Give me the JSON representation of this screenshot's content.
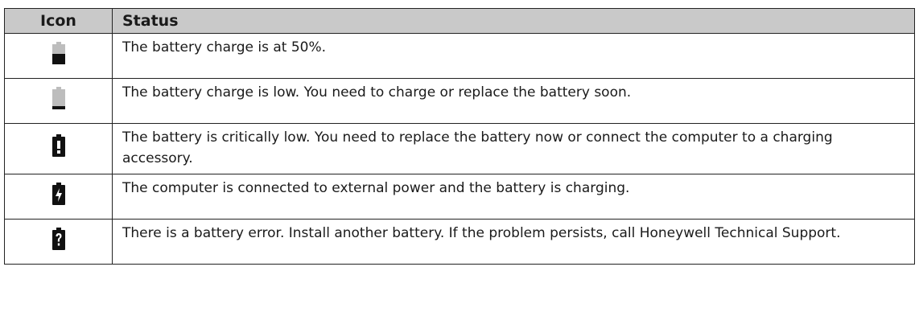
{
  "table": {
    "headers": {
      "icon": "Icon",
      "status": "Status"
    },
    "rows": [
      {
        "icon": "battery-half-icon",
        "status": "The battery charge is at 50%."
      },
      {
        "icon": "battery-low-icon",
        "status": "The battery charge is low. You need to charge or replace the battery soon."
      },
      {
        "icon": "battery-critical-icon",
        "status": "The battery is critically low. You need to replace the battery now or connect the computer to a charging accessory."
      },
      {
        "icon": "battery-charging-icon",
        "status": "The computer is connected to external power and the battery is charging."
      },
      {
        "icon": "battery-error-icon",
        "status": "There is a battery error. Install another battery. If the problem persists, call Honeywell Technical Support."
      }
    ]
  },
  "colors": {
    "header_bg": "#c9c9c9",
    "icon_dark": "#111111",
    "icon_light": "#bdbdbd"
  }
}
